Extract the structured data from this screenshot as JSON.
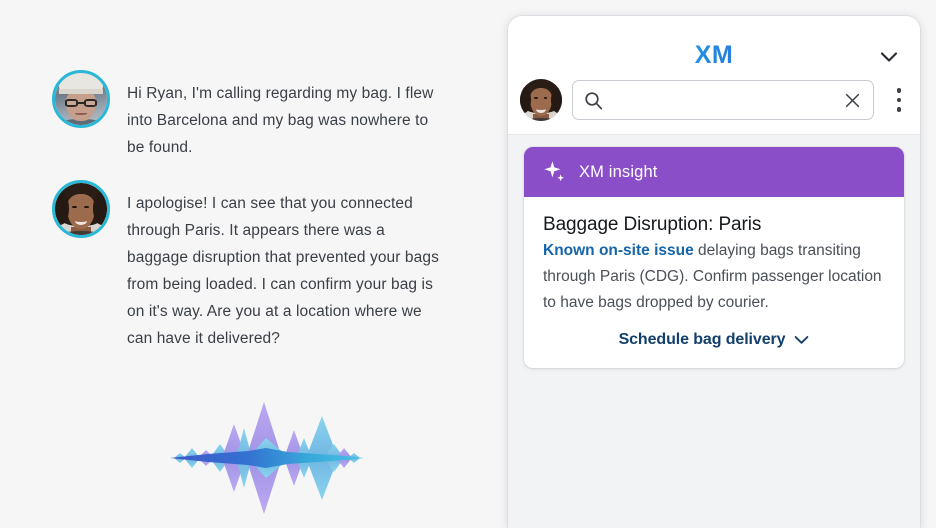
{
  "conversation": {
    "messages": [
      {
        "speaker_avatar": "customer-avatar",
        "text": "Hi Ryan, I'm calling regarding my bag. I flew into Barcelona and my bag was nowhere to be found."
      },
      {
        "speaker_avatar": "agent-avatar",
        "text": "I apologise! I can see that you connected through Paris. It appears there was a baggage disruption that prevented your bags from being loaded. I can confirm your bag is on it's way. Are you at a location where we can have it delivered?"
      }
    ],
    "waveform_label": "audio-waveform"
  },
  "panel": {
    "logo_text": "XM",
    "collapse_icon": "chevron-down-icon",
    "search": {
      "value": "",
      "placeholder": "",
      "search_icon": "search-icon",
      "clear_icon": "close-icon"
    },
    "more_icon": "more-vertical-icon",
    "avatar_name": "agent-avatar"
  },
  "insight_card": {
    "header_icon": "sparkle-ai-icon",
    "header_label": "XM insight",
    "title": "Baggage Disruption: Paris",
    "link_text": "Known on-site issue",
    "body_text": " delaying bags transiting through Paris (CDG). Confirm passenger location to have bags dropped by courier.",
    "cta_label": "Schedule bag delivery",
    "cta_icon": "chevron-down-icon"
  },
  "colors": {
    "page_background": "#f6f6f7",
    "panel_background": "#f2f3f4",
    "insight_header_purple": "#8a4ec8",
    "link_blue": "#1565a8",
    "cta_navy": "#133f6b",
    "avatar_ring_cyan": "#2ab8d8",
    "logo_gradient_start": "#18c7d4",
    "logo_gradient_end": "#7a3fd6",
    "waveform_purple": "#9b8fe8",
    "waveform_blue": "#4a6fd4",
    "waveform_cyan": "#5bc8e8"
  }
}
